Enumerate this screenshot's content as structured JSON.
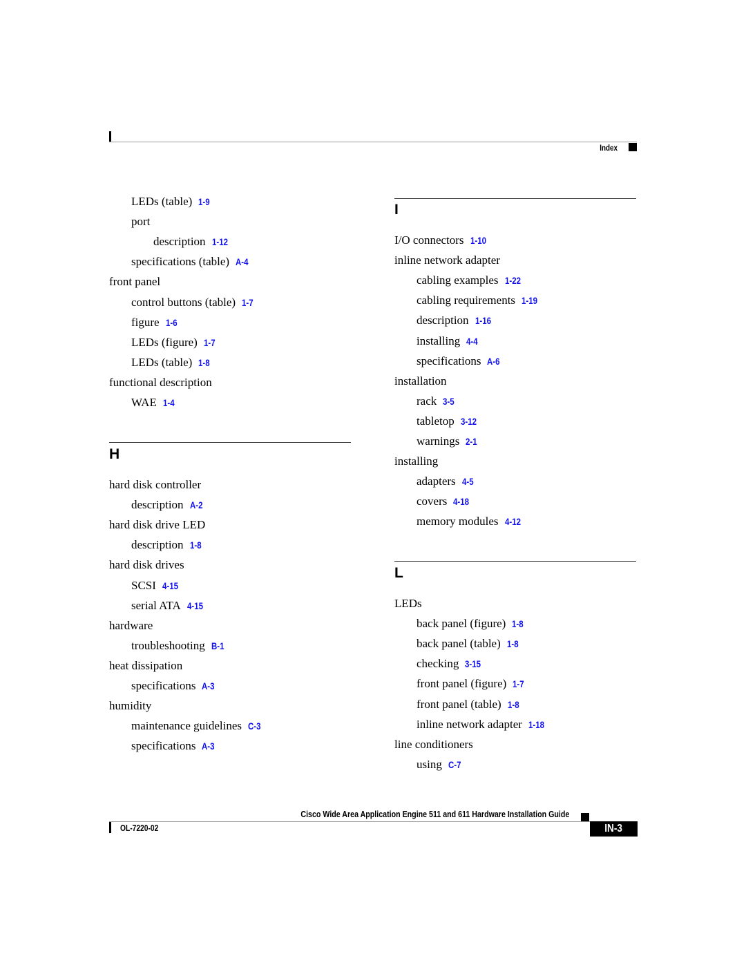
{
  "header": {
    "section_label": "Index"
  },
  "left_column": {
    "continued_entries": [
      {
        "level": 2,
        "text": "LEDs (table)",
        "ref": "1-9"
      },
      {
        "level": 2,
        "text": "port",
        "ref": ""
      },
      {
        "level": 3,
        "text": "description",
        "ref": "1-12"
      },
      {
        "level": 2,
        "text": "specifications (table)",
        "ref": "A-4"
      },
      {
        "level": 1,
        "text": "front panel",
        "ref": ""
      },
      {
        "level": 2,
        "text": "control buttons (table)",
        "ref": "1-7"
      },
      {
        "level": 2,
        "text": "figure",
        "ref": "1-6"
      },
      {
        "level": 2,
        "text": "LEDs (figure)",
        "ref": "1-7"
      },
      {
        "level": 2,
        "text": "LEDs (table)",
        "ref": "1-8"
      },
      {
        "level": 1,
        "text": "functional description",
        "ref": ""
      },
      {
        "level": 2,
        "text": "WAE",
        "ref": "1-4"
      }
    ],
    "section_h": {
      "letter": "H",
      "entries": [
        {
          "level": 1,
          "text": "hard disk controller",
          "ref": ""
        },
        {
          "level": 2,
          "text": "description",
          "ref": "A-2"
        },
        {
          "level": 1,
          "text": "hard disk drive LED",
          "ref": ""
        },
        {
          "level": 2,
          "text": "description",
          "ref": "1-8"
        },
        {
          "level": 1,
          "text": "hard disk drives",
          "ref": ""
        },
        {
          "level": 2,
          "text": "SCSI",
          "ref": "4-15"
        },
        {
          "level": 2,
          "text": "serial ATA",
          "ref": "4-15"
        },
        {
          "level": 1,
          "text": "hardware",
          "ref": ""
        },
        {
          "level": 2,
          "text": "troubleshooting",
          "ref": "B-1"
        },
        {
          "level": 1,
          "text": "heat dissipation",
          "ref": ""
        },
        {
          "level": 2,
          "text": "specifications",
          "ref": "A-3"
        },
        {
          "level": 1,
          "text": "humidity",
          "ref": ""
        },
        {
          "level": 2,
          "text": "maintenance guidelines",
          "ref": "C-3"
        },
        {
          "level": 2,
          "text": "specifications",
          "ref": "A-3"
        }
      ]
    }
  },
  "right_column": {
    "section_i": {
      "letter": "I",
      "entries": [
        {
          "level": 1,
          "text": "I/O connectors",
          "ref": "1-10"
        },
        {
          "level": 1,
          "text": "inline network adapter",
          "ref": ""
        },
        {
          "level": 2,
          "text": "cabling examples",
          "ref": "1-22"
        },
        {
          "level": 2,
          "text": "cabling requirements",
          "ref": "1-19"
        },
        {
          "level": 2,
          "text": "description",
          "ref": "1-16"
        },
        {
          "level": 2,
          "text": "installing",
          "ref": "4-4"
        },
        {
          "level": 2,
          "text": "specifications",
          "ref": "A-6"
        },
        {
          "level": 1,
          "text": "installation",
          "ref": ""
        },
        {
          "level": 2,
          "text": "rack",
          "ref": "3-5"
        },
        {
          "level": 2,
          "text": "tabletop",
          "ref": "3-12"
        },
        {
          "level": 2,
          "text": "warnings",
          "ref": "2-1"
        },
        {
          "level": 1,
          "text": "installing",
          "ref": ""
        },
        {
          "level": 2,
          "text": "adapters",
          "ref": "4-5"
        },
        {
          "level": 2,
          "text": "covers",
          "ref": "4-18"
        },
        {
          "level": 2,
          "text": "memory modules",
          "ref": "4-12"
        }
      ]
    },
    "section_l": {
      "letter": "L",
      "entries": [
        {
          "level": 1,
          "text": "LEDs",
          "ref": ""
        },
        {
          "level": 2,
          "text": "back panel (figure)",
          "ref": "1-8"
        },
        {
          "level": 2,
          "text": "back panel (table)",
          "ref": "1-8"
        },
        {
          "level": 2,
          "text": "checking",
          "ref": "3-15"
        },
        {
          "level": 2,
          "text": "front panel (figure)",
          "ref": "1-7"
        },
        {
          "level": 2,
          "text": "front panel (table)",
          "ref": "1-8"
        },
        {
          "level": 2,
          "text": "inline network adapter",
          "ref": "1-18"
        },
        {
          "level": 1,
          "text": "line conditioners",
          "ref": ""
        },
        {
          "level": 2,
          "text": "using",
          "ref": "C-7"
        }
      ]
    }
  },
  "footer": {
    "guide_title": "Cisco Wide Area Application Engine 511 and 611 Hardware Installation Guide",
    "doc_number": "OL-7220-02",
    "page_number": "IN-3"
  }
}
